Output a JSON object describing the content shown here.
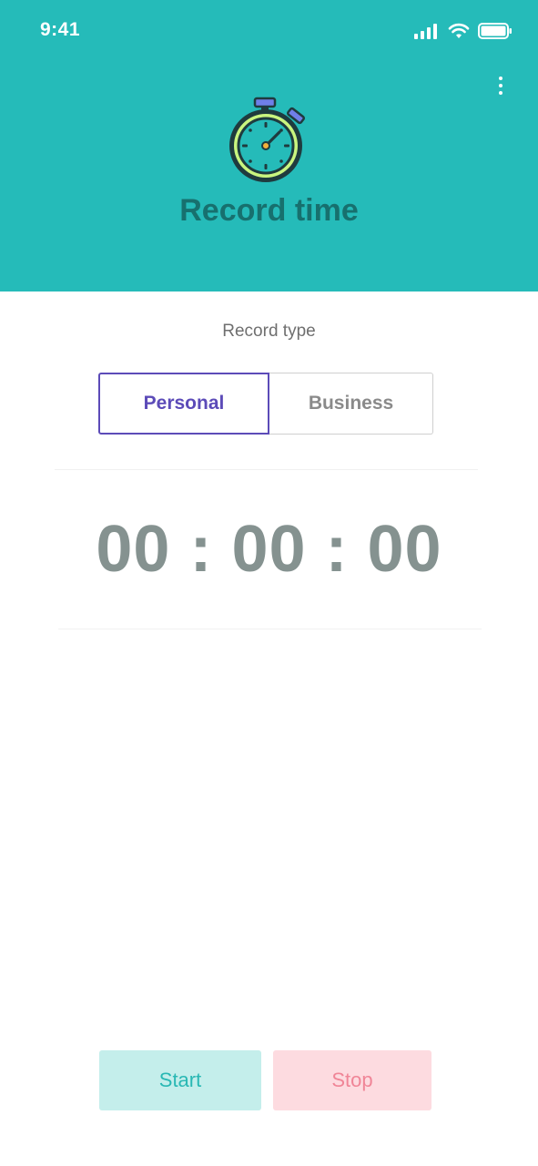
{
  "status_bar": {
    "time": "9:41"
  },
  "header": {
    "title": "Record time",
    "more_icon": "more-vertical-icon",
    "illustration": "stopwatch-icon"
  },
  "record_type": {
    "label": "Record type",
    "options": [
      "Personal",
      "Business"
    ],
    "selected": "Personal"
  },
  "timer": {
    "display": "00 : 00 : 00"
  },
  "actions": {
    "start_label": "Start",
    "stop_label": "Stop"
  },
  "colors": {
    "header_bg": "#25BBB9",
    "title": "#17706E",
    "selected_segment": "#5C4BB8",
    "timer_text": "#859290",
    "start_bg": "#C4EEEB",
    "start_text": "#29B8B4",
    "stop_bg": "#FDDBE0",
    "stop_text": "#F08597"
  }
}
